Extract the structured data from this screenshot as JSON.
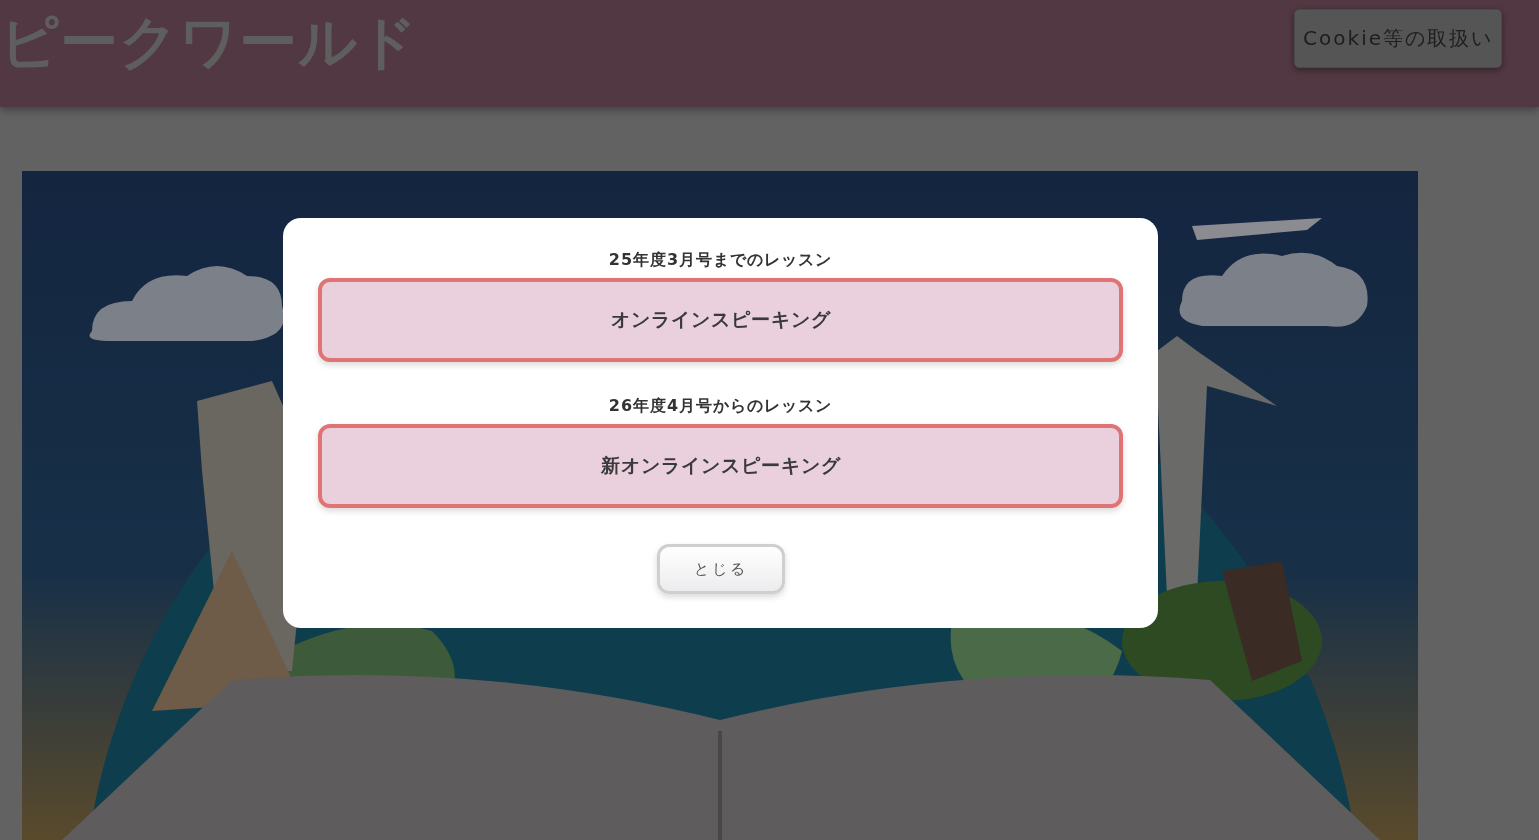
{
  "header": {
    "logo": "ピークワールド",
    "cookie_button": "Cookie等の取扱い"
  },
  "modal": {
    "options": [
      {
        "caption": "25年度3月号までのレッスン",
        "button": "オンラインスピーキング"
      },
      {
        "caption": "26年度4月号からのレッスン",
        "button": "新オンラインスピーキング"
      }
    ],
    "close_button": "とじる"
  }
}
